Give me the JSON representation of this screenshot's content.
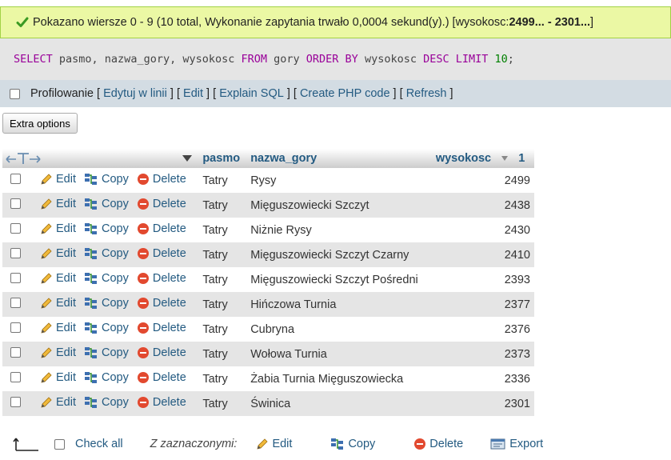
{
  "status": {
    "message": "Pokazano wiersze 0 - 9 (10 total, Wykonanie zapytania trwało 0,0004 sekund(y).) [wysokosc: ",
    "range": "2499... - 2301...",
    "close": "]"
  },
  "sql": {
    "kw_select": "SELECT",
    "cols": " pasmo, nazwa_gory, wysokosc ",
    "kw_from": "FROM",
    "table": " gory ",
    "kw_order": "ORDER BY",
    "order_col": " wysokosc ",
    "kw_desc": "DESC",
    "sp": " ",
    "kw_limit": "LIMIT",
    "limit_val": "10",
    "semicolon": ";"
  },
  "profiling": {
    "label": "Profilowanie",
    "links": [
      "Edytuj w linii",
      "Edit",
      "Explain SQL",
      "Create PHP code",
      "Refresh"
    ]
  },
  "extra_options": "Extra options",
  "table": {
    "headers": {
      "pasmo": "pasmo",
      "nazwa_gory": "nazwa_gory",
      "wysokosc": "wysokosc",
      "sort_index": "1"
    },
    "actions": {
      "edit": "Edit",
      "copy": "Copy",
      "delete": "Delete"
    },
    "rows": [
      {
        "pasmo": "Tatry",
        "nazwa": "Rysy",
        "wysokosc": "2499"
      },
      {
        "pasmo": "Tatry",
        "nazwa": "Mięguszowiecki Szczyt",
        "wysokosc": "2438"
      },
      {
        "pasmo": "Tatry",
        "nazwa": "Niżnie Rysy",
        "wysokosc": "2430"
      },
      {
        "pasmo": "Tatry",
        "nazwa": "Mięguszowiecki Szczyt Czarny",
        "wysokosc": "2410"
      },
      {
        "pasmo": "Tatry",
        "nazwa": "Mięguszowiecki Szczyt Pośredni",
        "wysokosc": "2393"
      },
      {
        "pasmo": "Tatry",
        "nazwa": "Hińczowa Turnia",
        "wysokosc": "2377"
      },
      {
        "pasmo": "Tatry",
        "nazwa": "Cubryna",
        "wysokosc": "2376"
      },
      {
        "pasmo": "Tatry",
        "nazwa": "Wołowa Turnia",
        "wysokosc": "2373"
      },
      {
        "pasmo": "Tatry",
        "nazwa": "Żabia Turnia Mięguszowiecka",
        "wysokosc": "2336"
      },
      {
        "pasmo": "Tatry",
        "nazwa": "Świnica",
        "wysokosc": "2301"
      }
    ]
  },
  "footer": {
    "check_all": "Check all",
    "with_selected": "Z zaznaczonymi:",
    "edit": "Edit",
    "copy": "Copy",
    "delete": "Delete",
    "export": "Export"
  },
  "colors": {
    "success_bg": "#ebf8a4",
    "link": "#235a81",
    "row_alt": "#e5e5e5"
  }
}
